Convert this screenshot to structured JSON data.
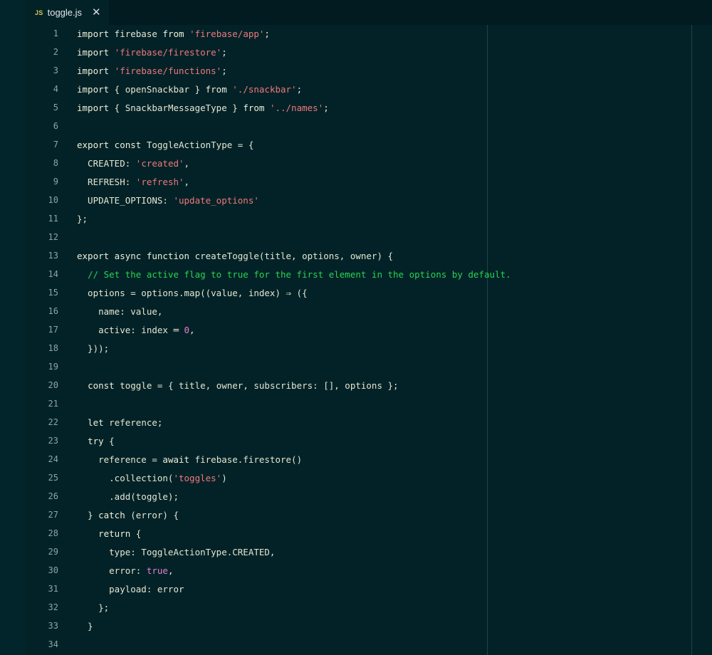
{
  "tab": {
    "badge": "JS",
    "filename": "toggle.js",
    "close": "✕"
  },
  "colors": {
    "background": "#022228",
    "string": "#f0787a",
    "comment": "#2bd44f",
    "number": "#e67ed0",
    "keyword": "#f1f0d8"
  },
  "lines": [
    {
      "n": "1",
      "tokens": [
        [
          "kw",
          "import"
        ],
        [
          "pl",
          " firebase "
        ],
        [
          "kw",
          "from"
        ],
        [
          "pl",
          " "
        ],
        [
          "str",
          "'firebase/app'"
        ],
        [
          "pl",
          ";"
        ]
      ]
    },
    {
      "n": "2",
      "tokens": [
        [
          "kw",
          "import"
        ],
        [
          "pl",
          " "
        ],
        [
          "str",
          "'firebase/firestore'"
        ],
        [
          "pl",
          ";"
        ]
      ]
    },
    {
      "n": "3",
      "tokens": [
        [
          "kw",
          "import"
        ],
        [
          "pl",
          " "
        ],
        [
          "str",
          "'firebase/functions'"
        ],
        [
          "pl",
          ";"
        ]
      ]
    },
    {
      "n": "4",
      "tokens": [
        [
          "kw",
          "import"
        ],
        [
          "pl",
          " { openSnackbar } "
        ],
        [
          "kw",
          "from"
        ],
        [
          "pl",
          " "
        ],
        [
          "str",
          "'./snackbar'"
        ],
        [
          "pl",
          ";"
        ]
      ]
    },
    {
      "n": "5",
      "tokens": [
        [
          "kw",
          "import"
        ],
        [
          "pl",
          " { SnackbarMessageType } "
        ],
        [
          "kw",
          "from"
        ],
        [
          "pl",
          " "
        ],
        [
          "str",
          "'../names'"
        ],
        [
          "pl",
          ";"
        ]
      ]
    },
    {
      "n": "6",
      "tokens": []
    },
    {
      "n": "7",
      "tokens": [
        [
          "kw",
          "export const"
        ],
        [
          "pl",
          " ToggleActionType = {"
        ]
      ]
    },
    {
      "n": "8",
      "tokens": [
        [
          "pl",
          "  CREATED: "
        ],
        [
          "str",
          "'created'"
        ],
        [
          "pl",
          ","
        ]
      ]
    },
    {
      "n": "9",
      "tokens": [
        [
          "pl",
          "  REFRESH: "
        ],
        [
          "str",
          "'refresh'"
        ],
        [
          "pl",
          ","
        ]
      ]
    },
    {
      "n": "10",
      "tokens": [
        [
          "pl",
          "  UPDATE_OPTIONS: "
        ],
        [
          "str",
          "'update_options'"
        ]
      ]
    },
    {
      "n": "11",
      "tokens": [
        [
          "pl",
          "};"
        ]
      ]
    },
    {
      "n": "12",
      "tokens": []
    },
    {
      "n": "13",
      "tokens": [
        [
          "kw",
          "export async function"
        ],
        [
          "pl",
          " createToggle(title, options, owner) {"
        ]
      ]
    },
    {
      "n": "14",
      "tokens": [
        [
          "pl",
          "  "
        ],
        [
          "cmt",
          "// Set the active flag to true for the first element in the options by default."
        ]
      ]
    },
    {
      "n": "15",
      "tokens": [
        [
          "pl",
          "  options = options.map((value, index) ⇒ ({"
        ]
      ]
    },
    {
      "n": "16",
      "tokens": [
        [
          "pl",
          "    name: value,"
        ]
      ]
    },
    {
      "n": "17",
      "tokens": [
        [
          "pl",
          "    active: index ═ "
        ],
        [
          "num",
          "0"
        ],
        [
          "pl",
          ","
        ]
      ]
    },
    {
      "n": "18",
      "tokens": [
        [
          "pl",
          "  }));"
        ]
      ]
    },
    {
      "n": "19",
      "tokens": []
    },
    {
      "n": "20",
      "tokens": [
        [
          "pl",
          "  "
        ],
        [
          "kw",
          "const"
        ],
        [
          "pl",
          " toggle = { title, owner, subscribers: [], options };"
        ]
      ]
    },
    {
      "n": "21",
      "tokens": []
    },
    {
      "n": "22",
      "tokens": [
        [
          "pl",
          "  "
        ],
        [
          "kw",
          "let"
        ],
        [
          "pl",
          " reference;"
        ]
      ]
    },
    {
      "n": "23",
      "tokens": [
        [
          "pl",
          "  "
        ],
        [
          "kw",
          "try"
        ],
        [
          "pl",
          " {"
        ]
      ]
    },
    {
      "n": "24",
      "tokens": [
        [
          "pl",
          "    reference = "
        ],
        [
          "kw",
          "await"
        ],
        [
          "pl",
          " firebase.firestore()"
        ]
      ]
    },
    {
      "n": "25",
      "tokens": [
        [
          "pl",
          "      .collection("
        ],
        [
          "str",
          "'toggles'"
        ],
        [
          "pl",
          ")"
        ]
      ]
    },
    {
      "n": "26",
      "tokens": [
        [
          "pl",
          "      .add(toggle);"
        ]
      ]
    },
    {
      "n": "27",
      "tokens": [
        [
          "pl",
          "  } "
        ],
        [
          "kw",
          "catch"
        ],
        [
          "pl",
          " (error) {"
        ]
      ]
    },
    {
      "n": "28",
      "tokens": [
        [
          "pl",
          "    "
        ],
        [
          "kw",
          "return"
        ],
        [
          "pl",
          " {"
        ]
      ]
    },
    {
      "n": "29",
      "tokens": [
        [
          "pl",
          "      type: ToggleActionType.CREATED,"
        ]
      ]
    },
    {
      "n": "30",
      "tokens": [
        [
          "pl",
          "      error: "
        ],
        [
          "num",
          "true"
        ],
        [
          "pl",
          ","
        ]
      ]
    },
    {
      "n": "31",
      "tokens": [
        [
          "pl",
          "      payload: error"
        ]
      ]
    },
    {
      "n": "32",
      "tokens": [
        [
          "pl",
          "    };"
        ]
      ]
    },
    {
      "n": "33",
      "tokens": [
        [
          "pl",
          "  }"
        ]
      ]
    },
    {
      "n": "34",
      "tokens": []
    }
  ]
}
